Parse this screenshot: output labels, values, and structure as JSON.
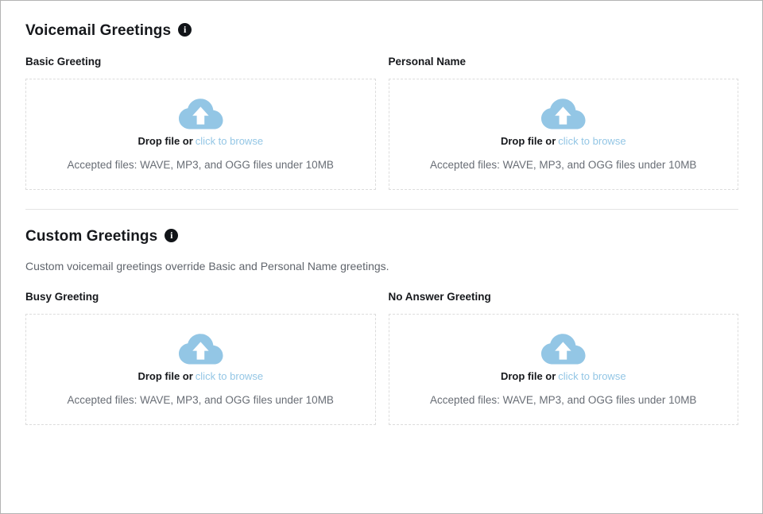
{
  "sections": [
    {
      "title": "Voicemail Greetings",
      "info_icon": "info-icon",
      "description": "",
      "columns": [
        {
          "label": "Basic Greeting",
          "dropzone": {
            "icon": "cloud-upload-icon",
            "drop_text": "Drop file or",
            "browse_link": "click to browse",
            "accepted_files": "Accepted files: WAVE, MP3, and OGG files under 10MB"
          }
        },
        {
          "label": "Personal Name",
          "dropzone": {
            "icon": "cloud-upload-icon",
            "drop_text": "Drop file or",
            "browse_link": "click to browse",
            "accepted_files": "Accepted files: WAVE, MP3, and OGG files under 10MB"
          }
        }
      ]
    },
    {
      "title": "Custom Greetings",
      "info_icon": "info-icon",
      "description": "Custom voicemail greetings override Basic and Personal Name greetings.",
      "columns": [
        {
          "label": "Busy Greeting",
          "dropzone": {
            "icon": "cloud-upload-icon",
            "drop_text": "Drop file or",
            "browse_link": "click to browse",
            "accepted_files": "Accepted files: WAVE, MP3, and OGG files under 10MB"
          }
        },
        {
          "label": "No Answer Greeting",
          "dropzone": {
            "icon": "cloud-upload-icon",
            "drop_text": "Drop file or",
            "browse_link": "click to browse",
            "accepted_files": "Accepted files: WAVE, MP3, and OGG files under 10MB"
          }
        }
      ]
    }
  ],
  "colors": {
    "cloud_blue": "#93c6e5",
    "link_blue": "#93c6e5",
    "heading": "#16181c",
    "muted_text": "#686d75",
    "dashed_border": "#dcdcdc",
    "page_border": "#b3b3b3",
    "divider": "#e4e4e4",
    "info_badge": "#111418"
  }
}
